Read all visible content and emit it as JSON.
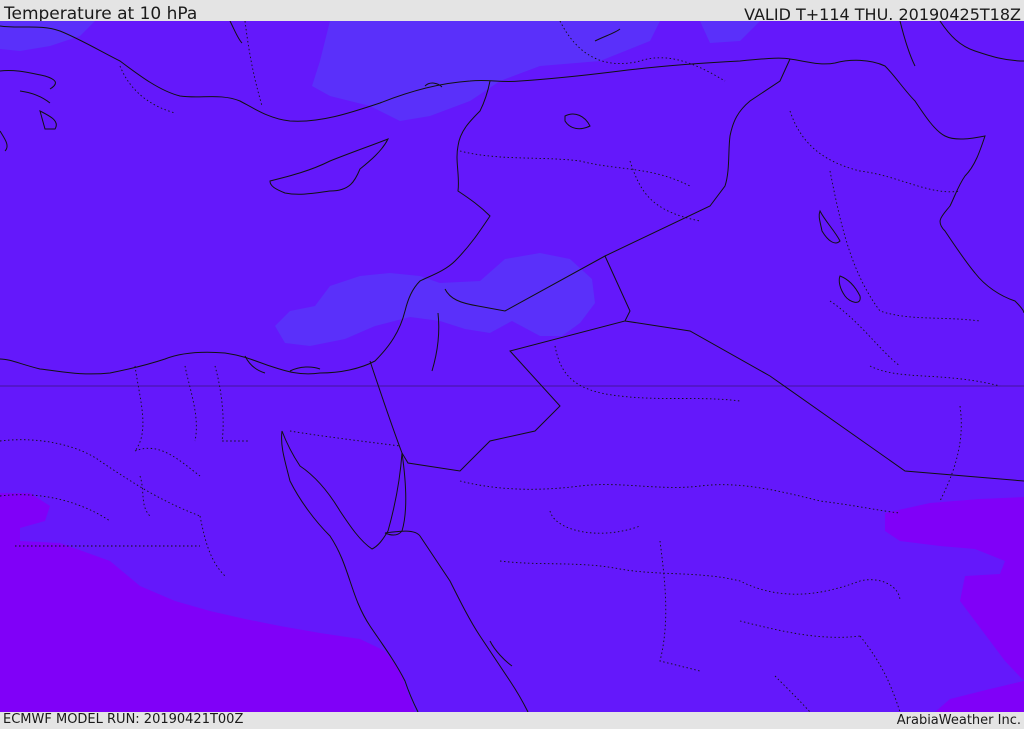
{
  "header": {
    "title": "Temperature at 10 hPa",
    "valid_time": "VALID T+114 THU. 20190425T18Z"
  },
  "footer": {
    "model_run": "ECMWF MODEL RUN: 20190421T00Z",
    "credit": "ArabiaWeather Inc."
  },
  "map": {
    "field": "temperature",
    "level": "10 hPa",
    "colors": {
      "base": "#6418fb",
      "warm_patch": "#8000f8",
      "cool_patch": "#5a30fa",
      "coastline": "#111111",
      "border": "#111111"
    }
  }
}
